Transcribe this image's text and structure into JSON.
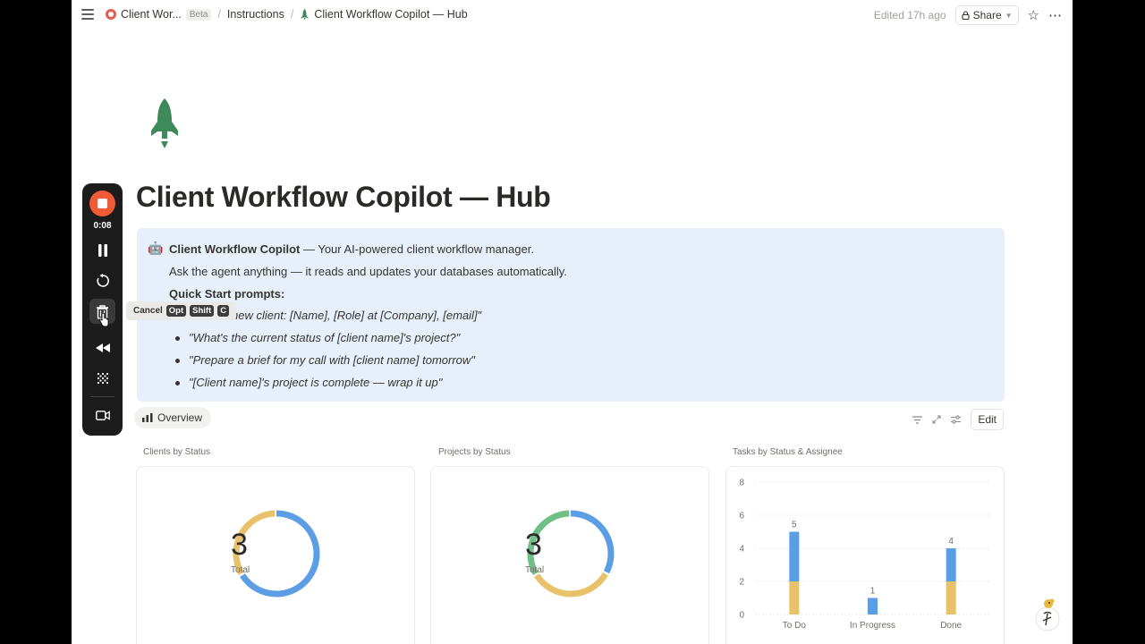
{
  "topbar": {
    "app_name": "Client Wor...",
    "beta_label": "Beta",
    "crumb_instructions": "Instructions",
    "crumb_page": "Client Workflow Copilot — Hub",
    "separator": "/",
    "edited": "Edited 17h ago",
    "share_label": "Share",
    "icons": [
      "menu-icon",
      "lock-icon",
      "star-icon",
      "more-icon"
    ]
  },
  "page": {
    "title": "Client Workflow Copilot — Hub",
    "icon": "rocket-icon"
  },
  "callout": {
    "icon": "robot-icon",
    "bold_name": "Client Workflow Copilot",
    "tagline": " — Your AI-powered client workflow manager.",
    "line2": "Ask the agent anything — it reads and updates your databases automatically.",
    "heading": "Quick Start prompts:",
    "prompts": [
      "new client: [Name], [Role] at [Company], [email]\"",
      "\"What's the current status of [client name]'s project?\"",
      "\"Prepare a brief for my call with [client name] tomorrow\"",
      "\"[Client name]'s project is complete — wrap it up\""
    ]
  },
  "view": {
    "tab_label": "Overview",
    "edit_label": "Edit",
    "icons": [
      "filter-icon",
      "expand-icon",
      "settings-icon"
    ]
  },
  "charts_labels": {
    "clients": "Clients by Status",
    "projects": "Projects by Status",
    "tasks": "Tasks by Status & Assignee"
  },
  "chart_data": [
    {
      "type": "pie",
      "title": "Clients by Status",
      "center_value": "3",
      "center_label": "Total",
      "slices": [
        {
          "color": "#5b9ee6",
          "value": 2
        },
        {
          "color": "#e8c26a",
          "value": 1
        }
      ]
    },
    {
      "type": "pie",
      "title": "Projects by Status",
      "center_value": "3",
      "center_label": "Total",
      "slices": [
        {
          "color": "#5b9ee6",
          "value": 1
        },
        {
          "color": "#e8c26a",
          "value": 1
        },
        {
          "color": "#6fbf86",
          "value": 1
        }
      ]
    },
    {
      "type": "bar",
      "title": "Tasks by Status & Assignee",
      "categories": [
        "To Do",
        "In Progress",
        "Done"
      ],
      "series": [
        {
          "color": "#e8c26a",
          "values": [
            2,
            0,
            2
          ]
        },
        {
          "color": "#5b9ee6",
          "values": [
            3,
            1,
            2
          ]
        }
      ],
      "totals": [
        "5",
        "1",
        "4"
      ],
      "yticks": [
        "0",
        "2",
        "4",
        "6",
        "8"
      ],
      "ylim": [
        0,
        8
      ]
    }
  ],
  "recorder": {
    "time": "0:08",
    "tooltip_cancel": "Cancel",
    "tooltip_keys": [
      "Opt",
      "Shift",
      "C"
    ],
    "icons": [
      "stop-icon",
      "pause-icon",
      "restart-icon",
      "trash-icon",
      "rewind-icon",
      "grid-icon",
      "camera-icon"
    ]
  },
  "colors": {
    "accent_blue": "#5b9ee6",
    "accent_yellow": "#e8c26a",
    "accent_green": "#6fbf86",
    "callout_bg": "#e7f0fa",
    "record_red": "#f05a36"
  }
}
